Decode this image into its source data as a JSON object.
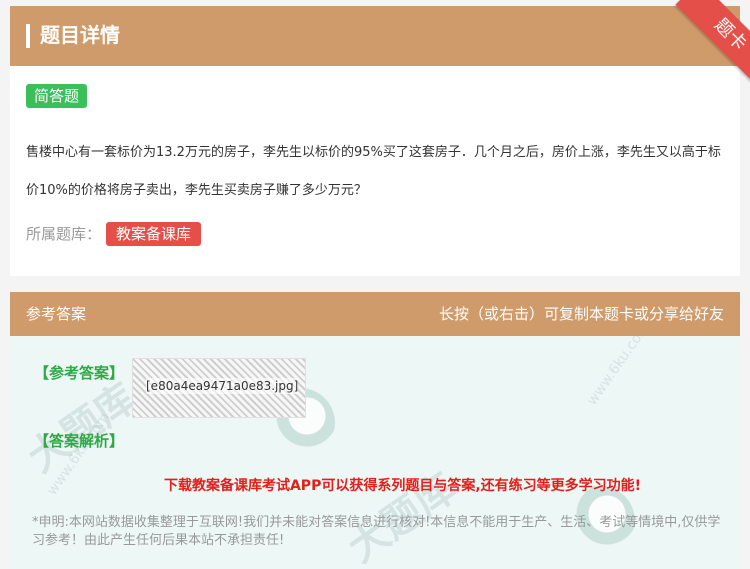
{
  "header": {
    "title": "题目详情",
    "ribbon_label": "题卡"
  },
  "question": {
    "type": "简答题",
    "text": "售楼中心有一套标价为13.2万元的房子，李先生以标价的95%买了这套房子．几个月之后，房价上涨，李先生又以高于标价10%的价格将房子卖出，李先生买卖房子赚了多少万元？",
    "bank_label": "所属题库：",
    "bank_name": "教案备课库"
  },
  "answer": {
    "header_title": "参考答案",
    "header_hint": "长按（或右击）可复制本题卡或分享给好友",
    "ref_label": "【参考答案】",
    "image_name": "[e80a4ea9471a0e83.jpg]",
    "analysis_label": "【答案解析】",
    "promo": "下载教案备课库考试APP可以获得系列题目与答案,还有练习等更多学习功能!",
    "disclaimer": "*申明:本网站数据收集整理于互联网!我们并未能对答案信息进行核对!本信息不能用于生产、生活、考试等情境中,仅供学习参考！由此产生任何后果本站不承担责任!"
  },
  "watermark": {
    "text": "大题库",
    "url": "www.6ku.com"
  },
  "colors": {
    "header": "#d09b6b",
    "badge_green": "#3bbf5a",
    "badge_red": "#e45049",
    "answer_bg": "#edf7f6",
    "promo_red": "#e0201a"
  }
}
